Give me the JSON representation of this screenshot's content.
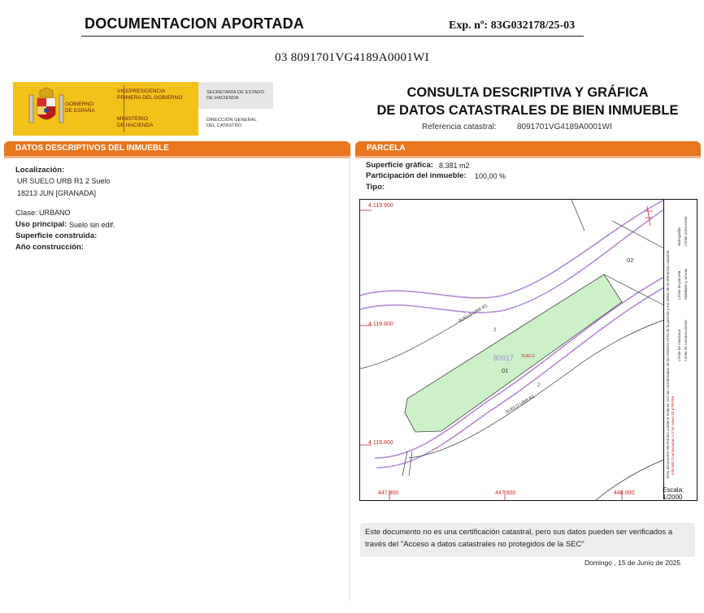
{
  "header": {
    "title": "DOCUMENTACION APORTADA",
    "expediente": "Exp. nº: 83G032178/25-03",
    "subref": "03 8091701VG4189A0001WI"
  },
  "logos": {
    "gobierno_line1": "GOBIERNO",
    "gobierno_line2": "DE ESPAÑA",
    "vice_line1": "VICEPRESIDENCIA",
    "vice_line2": "PRIMERA DEL GOBIERNO",
    "ministerio_line1": "MINISTERIO",
    "ministerio_line2": "DE HACIENDA",
    "secretaria_line1": "SECRETARÍA DE ESTADO",
    "secretaria_line2": "DE HACIENDA",
    "direccion_line1": "DIRECCIÓN GENERAL",
    "direccion_line2": "DEL CATASTRO"
  },
  "consulta": {
    "title_line1": "CONSULTA DESCRIPTIVA Y GRÁFICA",
    "title_line2": "DE DATOS CATASTRALES DE BIEN INMUEBLE",
    "refcat_label": "Referencia catastral:",
    "refcat_value": "8091701VG4189A0001WI"
  },
  "left_section": {
    "bar_label": "DATOS DESCRIPTIVOS DEL INMUEBLE",
    "localizacion_label": "Localización:",
    "localizacion_line1": "UR SUELO URB R1 2 Suelo",
    "localizacion_line2": "18213 JUN [GRANADA]",
    "clase_label": "Clase:",
    "clase_value": "URBANO",
    "uso_label": "Uso principal:",
    "uso_value": "Suelo sin edif.",
    "superficie_label": "Superficie construida:",
    "anio_label": "Año construcción:"
  },
  "right_section": {
    "bar_label": "PARCELA",
    "superficie_label": "Superficie gráfica:",
    "superficie_value": "8.381 m2",
    "participacion_label": "Participación del inmueble:",
    "participacion_value": "100,00 %",
    "tipo_label": "Tipo:"
  },
  "map": {
    "coord_y_top": "4.119.900",
    "coord_y_mid": "4.119.800",
    "coord_y_bottom": "4.119.800",
    "coord_x_left": "447.900",
    "coord_x_mid": "447.900",
    "coord_x_right": "448.000",
    "parcel_number": "80917",
    "parcel_tag": "SUELO",
    "parcel_sub": "01",
    "neighbor_label": "02",
    "street_label_upper": "SUELO URB R1",
    "street_label_lower": "SUELO URB R1",
    "street_number_upper": "2",
    "street_number_lower": "2",
    "colors": {
      "parcel_fill": "#ccf0c8",
      "road_line": "#b68ad8",
      "coord_text": "#cc2a2a"
    }
  },
  "legend": {
    "items": [
      "Límite de manzana",
      "Límite de parcela",
      "Límite de construcciones",
      "Mobiliario y aceras",
      "Límite zona verde",
      "Hidrografía"
    ],
    "utm_note": "448.000 Coordenadas U.T.M. Huso 30 ETRS89",
    "electronic_note": "Este documento electrónico contiene enlaces con las coordenadas de los vértices UTM de la parcela y los datos de la referencia catastral",
    "scale_label": "Escala:",
    "scale_value": "1/2000"
  },
  "note": {
    "text_line1": "Este documento no es una certificación catastral, pero sus datos pueden ser verificados a",
    "text_line2": "través del \"Acceso a datos catastrales no protegidos de la SEC\""
  },
  "footer": {
    "date": "Domingo , 15 de Junio de 2025"
  }
}
